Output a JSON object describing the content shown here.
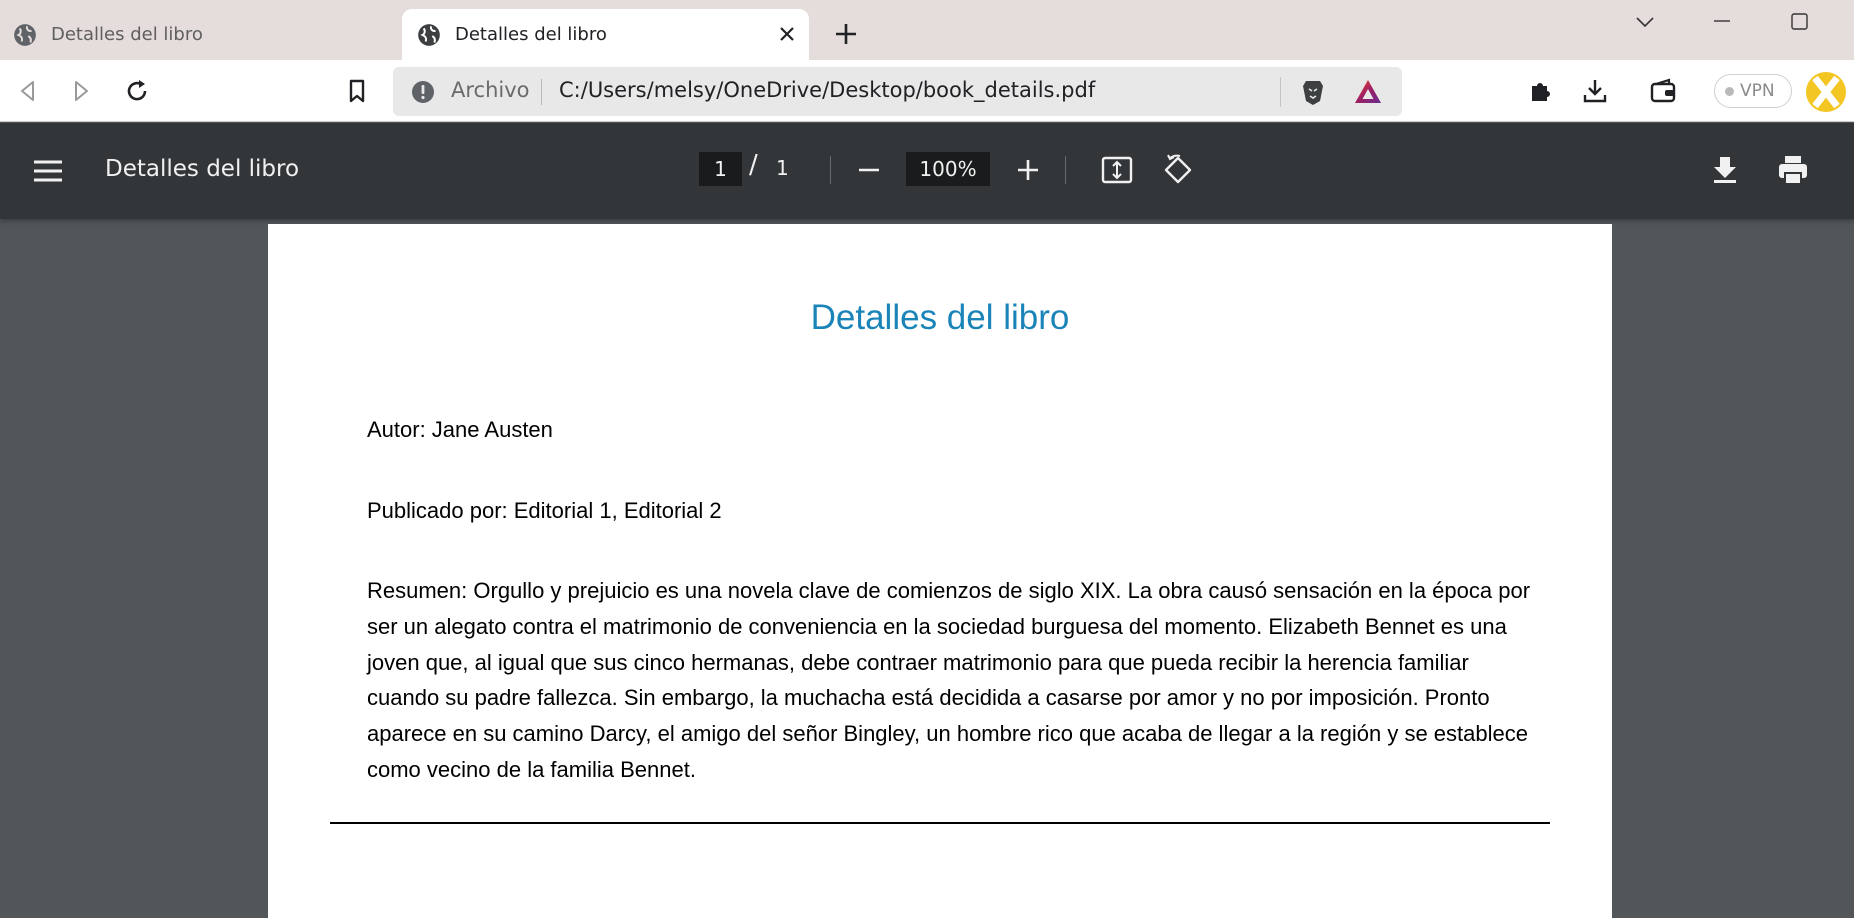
{
  "browser": {
    "tabs": [
      {
        "title": "Detalles del libro",
        "active": false
      },
      {
        "title": "Detalles del libro",
        "active": true
      }
    ],
    "omnibox": {
      "scheme_label": "Archivo",
      "url": "C:/Users/melsy/OneDrive/Desktop/book_details.pdf"
    },
    "vpn_label": "VPN",
    "icons": [
      "globe-icon",
      "close-icon",
      "plus-icon",
      "chevron-down-icon",
      "minimize-icon",
      "maximize-icon",
      "back-icon",
      "forward-icon",
      "reload-icon",
      "bookmark-icon",
      "info-icon",
      "brave-shields-icon",
      "brave-rewards-icon",
      "extensions-icon",
      "download-icon",
      "wallet-icon"
    ]
  },
  "pdf_viewer": {
    "title": "Detalles del libro",
    "current_page": "1",
    "page_separator": "/",
    "total_pages": "1",
    "zoom": "100%",
    "icons": [
      "menu-icon",
      "zoom-out-icon",
      "zoom-in-icon",
      "fit-page-icon",
      "rotate-icon",
      "download-icon",
      "print-icon"
    ]
  },
  "document": {
    "heading": "Detalles del libro",
    "author_line": "Autor: Jane Austen",
    "publisher_line": "Publicado por: Editorial 1, Editorial 2",
    "summary": "Resumen: Orgullo y prejuicio es una novela clave de comienzos de siglo XIX. La obra causó sensación en la época por ser un alegato contra el matrimonio de conveniencia en la sociedad burguesa del momento. Elizabeth Bennet es una joven que, al igual que sus cinco hermanas, debe contraer matrimonio para que pueda recibir la herencia familiar cuando su padre fallezca. Sin embargo, la muchacha está decidida a casarse por amor y no por imposición. Pronto aparece en su camino Darcy, el amigo del señor Bingley, un hombre rico que acaba de llegar a la región y se establece como vecino de la familia Bennet."
  },
  "colors": {
    "tabstrip": "#e5dcdc",
    "pdf_toolbar": "#323639",
    "viewer_background": "#525659",
    "heading": "#1a84b8"
  }
}
